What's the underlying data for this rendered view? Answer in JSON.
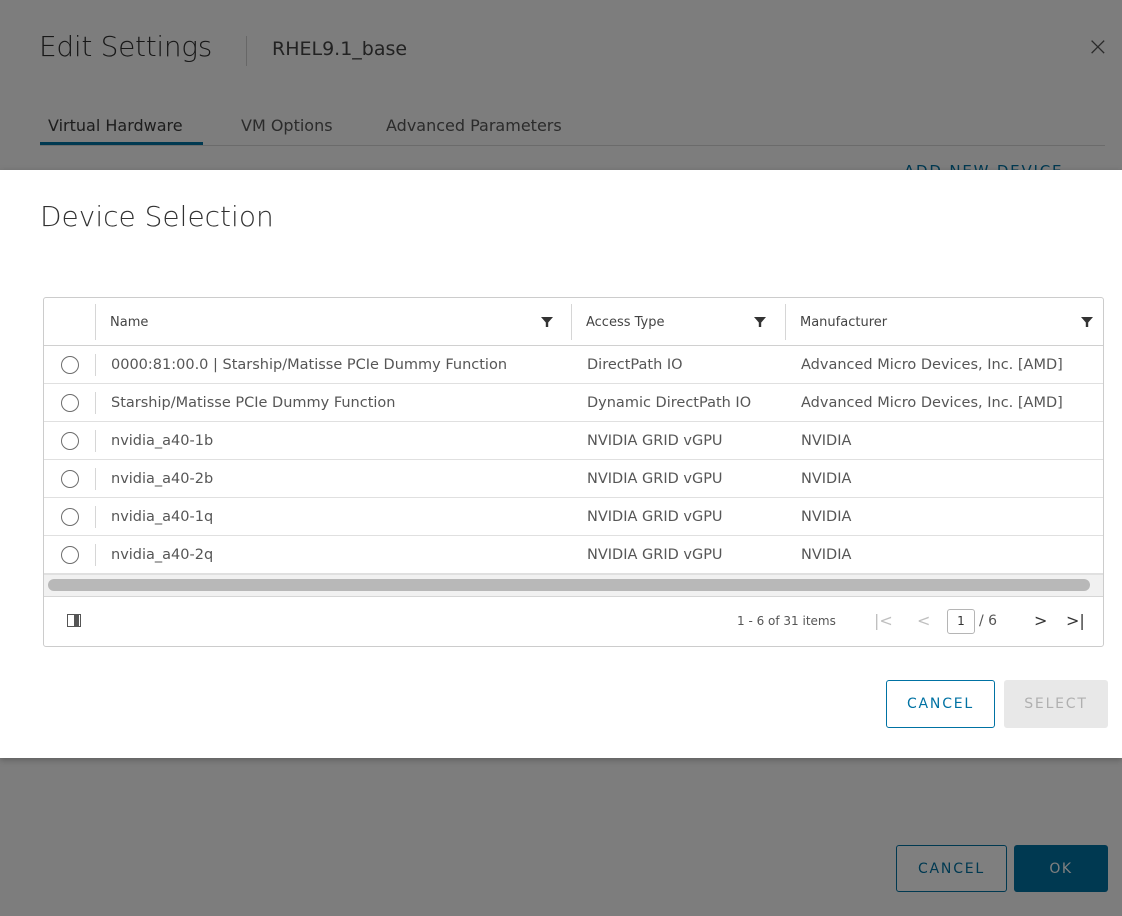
{
  "edit_settings": {
    "title": "Edit Settings",
    "vm_name": "RHEL9.1_base",
    "close_glyph": "×",
    "tabs": [
      {
        "label": "Virtual Hardware",
        "active": true
      },
      {
        "label": "VM Options",
        "active": false
      },
      {
        "label": "Advanced Parameters",
        "active": false
      }
    ],
    "add_new_device": "ADD NEW DEVICE ⌄",
    "cancel_label": "CANCEL",
    "ok_label": "OK"
  },
  "device_selection": {
    "title": "Device Selection",
    "columns": [
      {
        "label": "Name",
        "icon": "filter-icon"
      },
      {
        "label": "Access Type",
        "icon": "filter-icon"
      },
      {
        "label": "Manufacturer",
        "icon": "filter-icon"
      }
    ],
    "rows": [
      {
        "name": "0000:81:00.0 | Starship/Matisse PCIe Dummy Function",
        "access": "DirectPath IO",
        "manufacturer": "Advanced Micro Devices, Inc. [AMD]"
      },
      {
        "name": "Starship/Matisse PCIe Dummy Function",
        "access": "Dynamic DirectPath IO",
        "manufacturer": "Advanced Micro Devices, Inc. [AMD]"
      },
      {
        "name": "nvidia_a40-1b",
        "access": "NVIDIA GRID vGPU",
        "manufacturer": "NVIDIA"
      },
      {
        "name": "nvidia_a40-2b",
        "access": "NVIDIA GRID vGPU",
        "manufacturer": "NVIDIA"
      },
      {
        "name": "nvidia_a40-1q",
        "access": "NVIDIA GRID vGPU",
        "manufacturer": "NVIDIA"
      },
      {
        "name": "nvidia_a40-2q",
        "access": "NVIDIA GRID vGPU",
        "manufacturer": "NVIDIA"
      }
    ],
    "pagination": {
      "summary": "1 - 6 of 31 items",
      "current_page": "1",
      "total_pages": "/ 6",
      "first_glyph": "|<",
      "prev_glyph": "<",
      "next_glyph": ">",
      "last_glyph": ">|"
    },
    "cancel_label": "CANCEL",
    "select_label": "SELECT"
  },
  "colors": {
    "accent": "#0072a3",
    "scrim": "rgba(0,0,0,0.5)",
    "disabled_bg": "#e8e8e8"
  }
}
